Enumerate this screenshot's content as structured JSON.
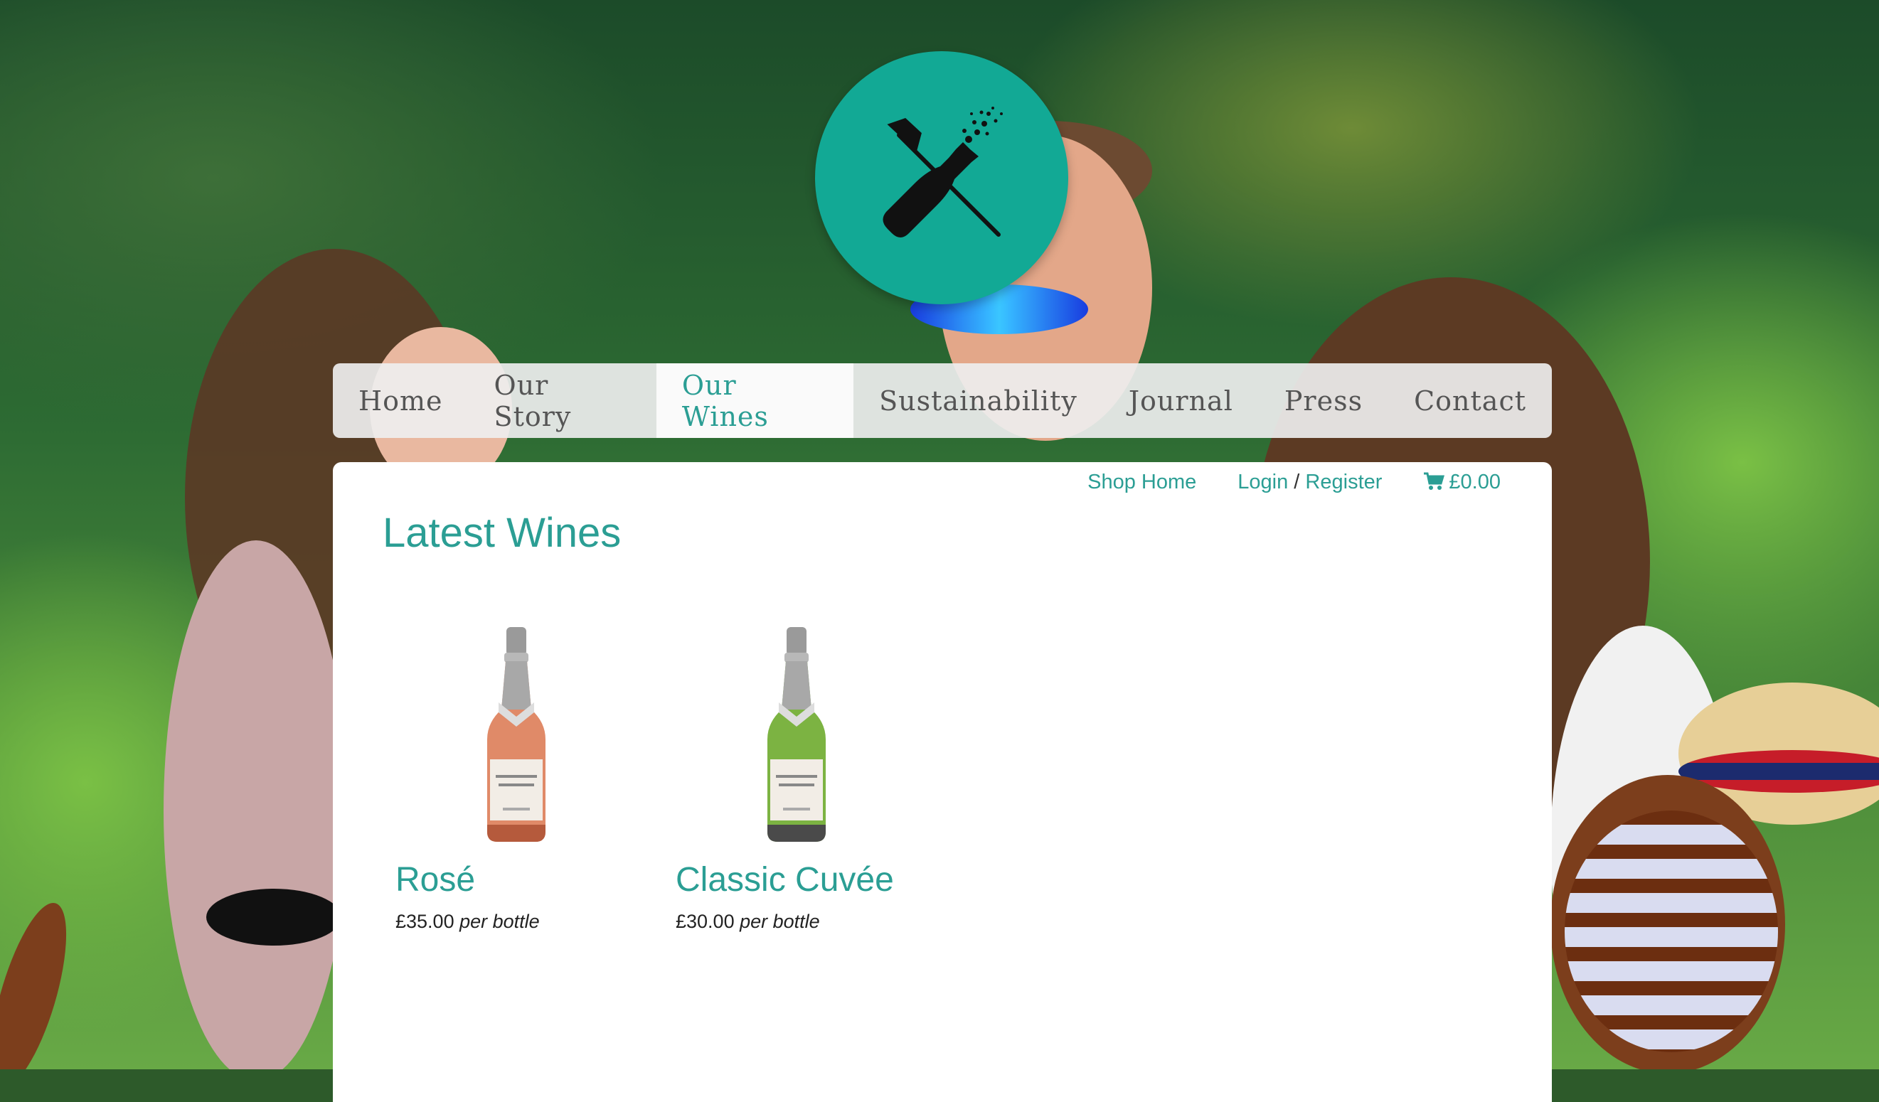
{
  "nav": {
    "items": [
      {
        "label": "Home"
      },
      {
        "label": "Our Story"
      },
      {
        "label": "Our Wines"
      },
      {
        "label": "Sustainability"
      },
      {
        "label": "Journal"
      },
      {
        "label": "Press"
      },
      {
        "label": "Contact"
      }
    ],
    "active_index": 2
  },
  "shopbar": {
    "shop_home": "Shop Home",
    "login": "Login",
    "separator": "/",
    "register": "Register",
    "cart_total": "£0.00",
    "cart_icon": "shopping-cart-icon"
  },
  "main": {
    "title": "Latest Wines",
    "products": [
      {
        "name": "Rosé",
        "price": "£35.00",
        "unit": "per bottle",
        "wine_color": "#e08a68"
      },
      {
        "name": "Classic Cuvée",
        "price": "£30.00",
        "unit": "per bottle",
        "wine_color": "#7cb342"
      }
    ]
  },
  "colors": {
    "accent": "#2b9e94",
    "logo_bg": "#12a995"
  }
}
